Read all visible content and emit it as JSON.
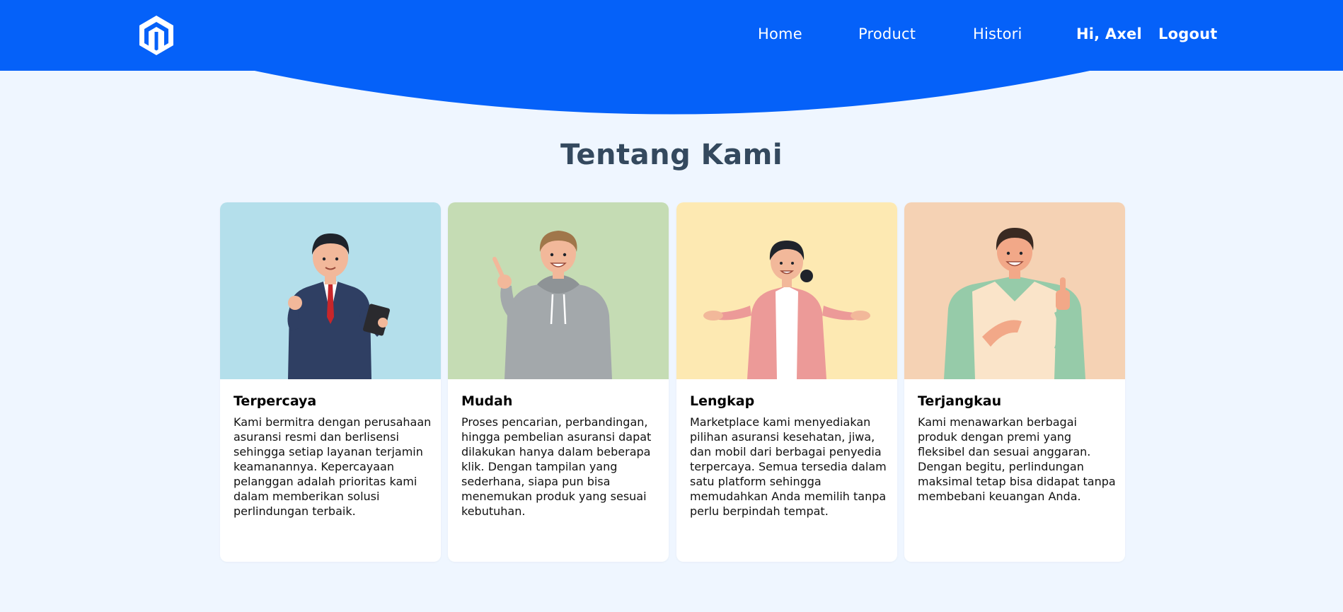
{
  "colors": {
    "header_blue": "#0561f9",
    "page_bg": "#eff6ff",
    "title": "#34495e",
    "card_bgs": [
      "#b4dfeb",
      "#c5dcb4",
      "#fde9b2",
      "#f5d2b4"
    ]
  },
  "header": {
    "logo_icon": "hexagon-m-logo-icon",
    "nav": {
      "home": "Home",
      "product": "Product",
      "histori": "Histori",
      "greeting": "Hi, Axel",
      "logout": "Logout"
    }
  },
  "main": {
    "title": "Tentang Kami",
    "cards": [
      {
        "title": "Terpercaya",
        "text": "Kami bermitra dengan perusahaan asuransi resmi dan berlisensi sehingga setiap layanan terjamin keamanannya. Kepercayaan pelanggan adalah prioritas kami dalam memberikan solusi perlindungan terbaik.",
        "illustration": "businessman-with-tablet-illustration"
      },
      {
        "title": "Mudah",
        "text": "Proses pencarian, perbandingan, hingga pembelian asuransi dapat dilakukan hanya dalam beberapa klik. Dengan tampilan yang sederhana, siapa pun bisa menemukan produk yang sesuai kebutuhan.",
        "illustration": "man-in-hoodie-pointing-illustration"
      },
      {
        "title": "Lengkap",
        "text": "Marketplace kami menyediakan pilihan asuransi kesehatan, jiwa, dan mobil dari berbagai penyedia terpercaya. Semua tersedia dalam satu platform sehingga memudahkan Anda memilih tanpa perlu berpindah tempat.",
        "illustration": "woman-presenting-illustration"
      },
      {
        "title": "Terjangkau",
        "text": "Kami menawarkan berbagai produk dengan premi yang fleksibel dan sesuai anggaran. Dengan begitu, perlindungan maksimal tetap bisa didapat tanpa membebani keuangan Anda.",
        "illustration": "man-thumbs-up-illustration"
      }
    ]
  }
}
